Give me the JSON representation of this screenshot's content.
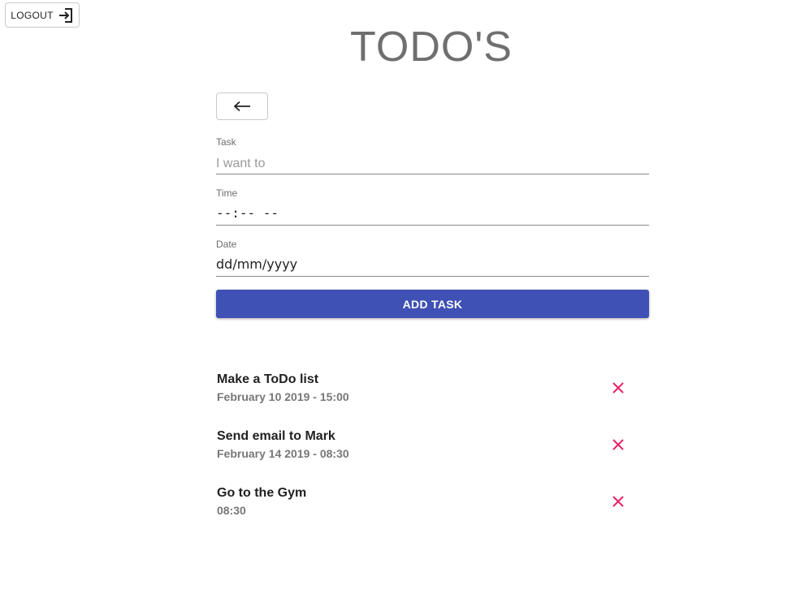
{
  "header": {
    "logout_label": "LOGOUT",
    "logout_icon": "exit-icon",
    "title": "TODO'S"
  },
  "navigation": {
    "back_icon": "arrow-left-icon"
  },
  "form": {
    "task": {
      "label": "Task",
      "placeholder": "I want to",
      "value": ""
    },
    "time": {
      "label": "Time",
      "value": "--:-- --"
    },
    "date": {
      "label": "Date",
      "value": "dd/mm/yyyy"
    },
    "add_button_label": "ADD TASK"
  },
  "todos": [
    {
      "title": "Make a ToDo list",
      "when": "February 10 2019 - 15:00"
    },
    {
      "title": "Send email to Mark",
      "when": "February 14 2019 - 08:30"
    },
    {
      "title": "Go to the Gym",
      "when": "08:30"
    }
  ],
  "icons": {
    "delete": "close-icon"
  },
  "colors": {
    "accent": "#3f51b5",
    "delete": "#e91e63",
    "title": "#6f6f6f"
  }
}
